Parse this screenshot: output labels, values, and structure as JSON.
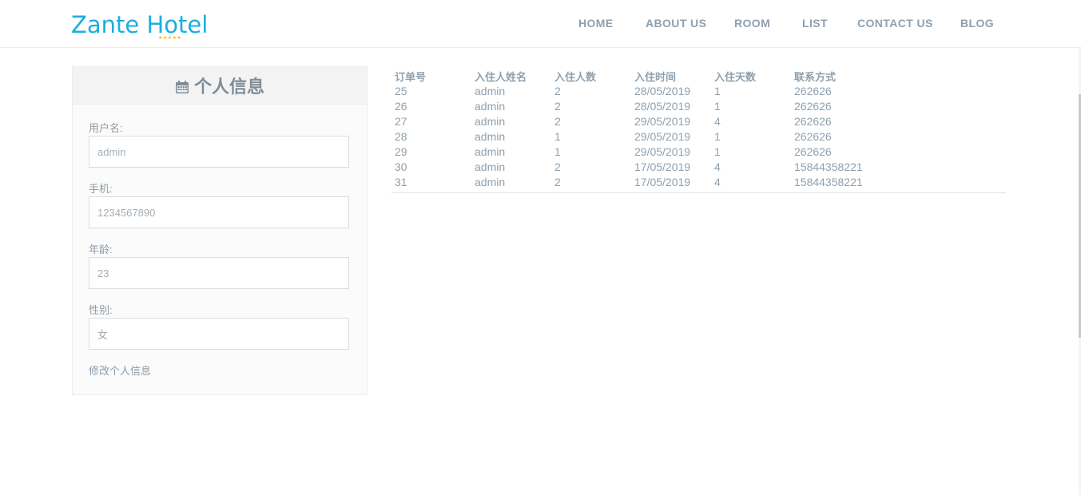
{
  "brand": {
    "logo_text": "Zante Hotel",
    "stars": "★★★★★",
    "logo_color": "#1aaedf",
    "star_color": "#f3b61b"
  },
  "nav": {
    "items": [
      {
        "label": "HOME"
      },
      {
        "label": "ABOUT US"
      },
      {
        "label": "ROOM"
      },
      {
        "label": "LIST"
      },
      {
        "label": "CONTACT US"
      },
      {
        "label": "BLOG"
      }
    ]
  },
  "profile": {
    "title": "个人信息",
    "title_icon": "calendar-icon",
    "fields": [
      {
        "label": "用户名:",
        "value": "admin"
      },
      {
        "label": "手机:",
        "value": "1234567890"
      },
      {
        "label": "年龄:",
        "value": "23"
      },
      {
        "label": "性别:",
        "value": "女"
      }
    ],
    "edit_label": "修改个人信息"
  },
  "orders": {
    "columns": [
      "订单号",
      "入住人姓名",
      "入住人数",
      "入住时间",
      "入住天数",
      "联系方式"
    ],
    "rows": [
      [
        "25",
        "admin",
        "2",
        "28/05/2019",
        "1",
        "262626"
      ],
      [
        "26",
        "admin",
        "2",
        "28/05/2019",
        "1",
        "262626"
      ],
      [
        "27",
        "admin",
        "2",
        "29/05/2019",
        "4",
        "262626"
      ],
      [
        "28",
        "admin",
        "1",
        "29/05/2019",
        "1",
        "262626"
      ],
      [
        "29",
        "admin",
        "1",
        "29/05/2019",
        "1",
        "262626"
      ],
      [
        "30",
        "admin",
        "2",
        "17/05/2019",
        "4",
        "15844358221"
      ],
      [
        "31",
        "admin",
        "2",
        "17/05/2019",
        "4",
        "15844358221"
      ]
    ]
  }
}
